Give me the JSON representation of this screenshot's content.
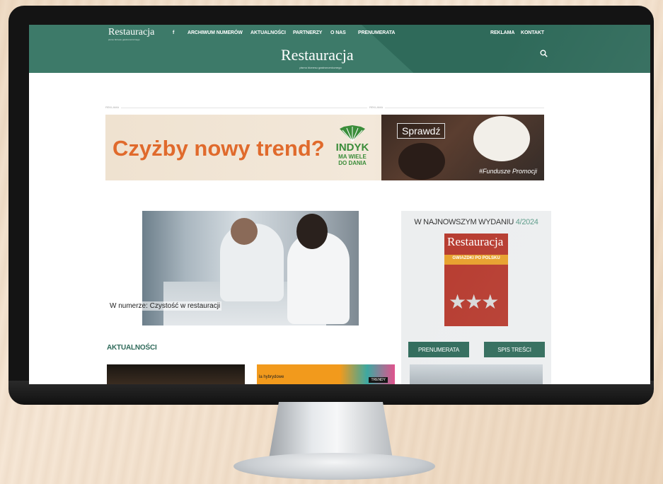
{
  "site": {
    "logo_small": "Restauracja",
    "logo_small_sub": "pismo biznesu gastronomicznego",
    "logo_big": "Restauracja",
    "logo_big_sub": "pismo biznesu gastronomicznego"
  },
  "nav": {
    "facebook": "f",
    "items": [
      "ARCHIWUM NUMERÓW",
      "AKTUALNOŚCI",
      "PARTNERZY",
      "O NAS",
      "PRENUMERATA"
    ],
    "right": [
      "REKLAMA",
      "KONTAKT"
    ],
    "search_icon": "search-icon"
  },
  "ad": {
    "label_left": "REKLAMA",
    "label_right": "REKLAMA",
    "headline": "Czyżby nowy trend?",
    "brand_line1": "INDYK",
    "brand_line2": "MA WIELE",
    "brand_line3": "DO DANIA",
    "cta": "Sprawdź",
    "footer": "#Fundusze Promocji"
  },
  "hero": {
    "caption": "W numerze: Czystość w restauracji"
  },
  "news": {
    "heading": "AKTUALNOŚCI",
    "thumb2_small": "la hybrydowe",
    "thumb2_tag": "TRENDY"
  },
  "sidebar": {
    "title": "W NAJNOWSZYM WYDANIU",
    "issue": "4/2024",
    "cover_title": "Restauracja",
    "cover_headline": "GWIAZDKI PO POLSKU",
    "subscribe_button": "PRENUMERATA",
    "toc_button": "SPIS TREŚCI"
  },
  "colors": {
    "brand_green": "#3d7a69",
    "dark_green": "#2f6a5a",
    "ad_orange": "#e06a2c"
  }
}
